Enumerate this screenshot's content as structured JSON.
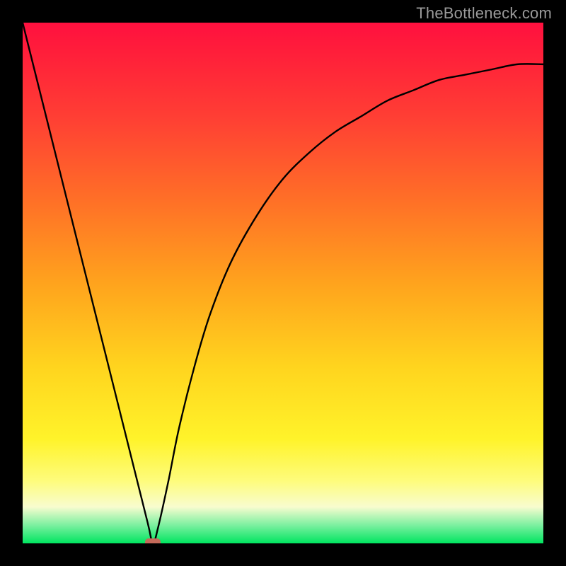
{
  "attribution": "TheBottleneck.com",
  "chart_data": {
    "type": "line",
    "title": "",
    "xlabel": "",
    "ylabel": "",
    "xlim": [
      0,
      100
    ],
    "ylim": [
      0,
      100
    ],
    "background_gradient_stops": [
      {
        "pos": 0,
        "color": "#ff103f"
      },
      {
        "pos": 18,
        "color": "#ff3e34"
      },
      {
        "pos": 34,
        "color": "#ff6f27"
      },
      {
        "pos": 50,
        "color": "#ffa31d"
      },
      {
        "pos": 66,
        "color": "#ffd41e"
      },
      {
        "pos": 80,
        "color": "#fff32a"
      },
      {
        "pos": 93,
        "color": "#f8fccf"
      },
      {
        "pos": 100,
        "color": "#00e560"
      }
    ],
    "series": [
      {
        "name": "bottleneck-curve",
        "x": [
          0,
          5,
          10,
          15,
          20,
          24,
          25,
          26,
          28,
          30,
          33,
          36,
          40,
          45,
          50,
          55,
          60,
          65,
          70,
          75,
          80,
          85,
          90,
          95,
          100
        ],
        "y": [
          100,
          80,
          60,
          40,
          20,
          4,
          0,
          3,
          12,
          22,
          34,
          44,
          54,
          63,
          70,
          75,
          79,
          82,
          85,
          87,
          89,
          90,
          91,
          92,
          92
        ]
      }
    ],
    "marker": {
      "name": "min-point",
      "x": 25,
      "y": 0,
      "color": "#c46a5a",
      "shape": "rounded-rect"
    }
  }
}
